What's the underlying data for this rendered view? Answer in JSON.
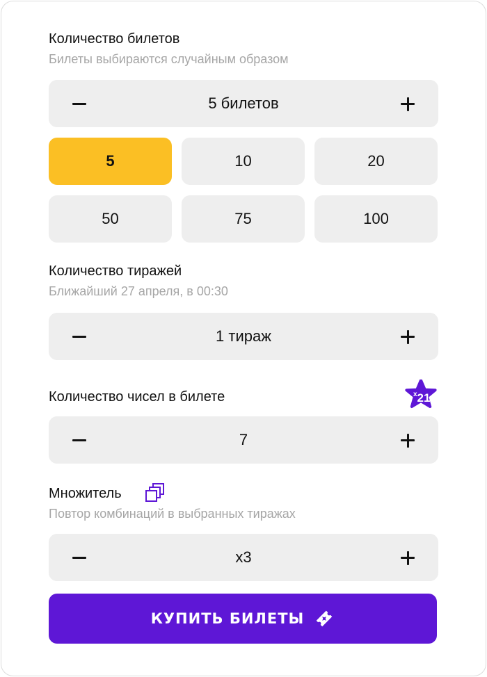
{
  "tickets": {
    "title": "Количество билетов",
    "subtitle": "Билеты выбираются случайным образом",
    "value": "5 билетов",
    "options": [
      "5",
      "10",
      "20",
      "50",
      "75",
      "100"
    ],
    "selected_option": "5"
  },
  "draws": {
    "title": "Количество тиражей",
    "subtitle": "Ближайший 27 апреля, в 00:30",
    "value": "1 тираж"
  },
  "numbers": {
    "title": "Количество чисел в билете",
    "value": "7",
    "badge_prefix": "x",
    "badge_value": "21"
  },
  "multiplier": {
    "title": "Множитель",
    "subtitle": "Повтор комбинаций в выбранных тиражах",
    "value": "x3"
  },
  "buy_button": {
    "label": "КУПИТЬ БИЛЕТЫ"
  },
  "colors": {
    "accent": "#5e17d6",
    "selected_chip": "#fbbf24",
    "control_bg": "#eeeeee",
    "muted_text": "#a6a6a6"
  },
  "icons": {
    "decrement": "minus-icon",
    "increment": "plus-icon",
    "badge": "star-badge-icon",
    "multiplier": "copy-stack-icon",
    "buy": "ticket-icon"
  }
}
